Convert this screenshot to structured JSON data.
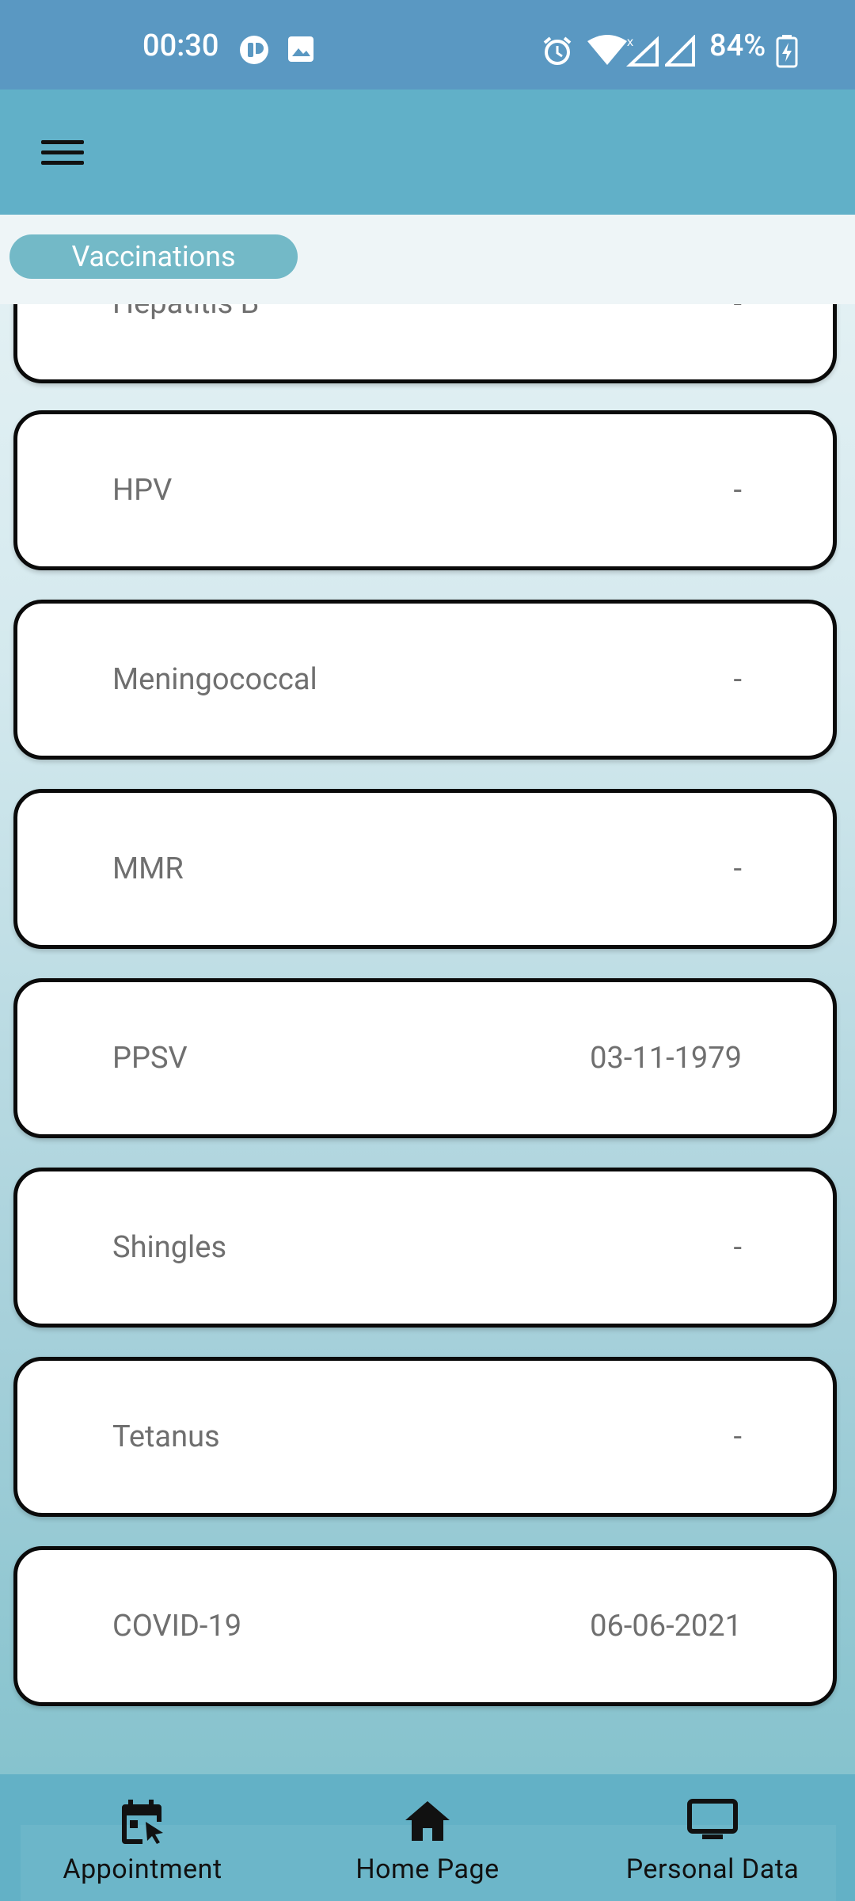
{
  "status_bar": {
    "time": "00:30",
    "battery": "84%"
  },
  "app_bar": {
    "menu_icon": "hamburger-menu-icon"
  },
  "section": {
    "title": "Vaccinations"
  },
  "vaccinations": [
    {
      "name": "Hepatitis B",
      "date": "-"
    },
    {
      "name": "HPV",
      "date": "-"
    },
    {
      "name": "Meningococcal",
      "date": "-"
    },
    {
      "name": "MMR",
      "date": "-"
    },
    {
      "name": "PPSV",
      "date": "03-11-1979"
    },
    {
      "name": "Shingles",
      "date": "-"
    },
    {
      "name": "Tetanus",
      "date": "-"
    },
    {
      "name": "COVID-19",
      "date": "06-06-2021"
    }
  ],
  "bottom_nav": {
    "items": [
      {
        "label": "Appointment",
        "icon": "calendar-icon"
      },
      {
        "label": "Home Page",
        "icon": "home-icon"
      },
      {
        "label": "Personal Data",
        "icon": "monitor-icon"
      }
    ]
  }
}
